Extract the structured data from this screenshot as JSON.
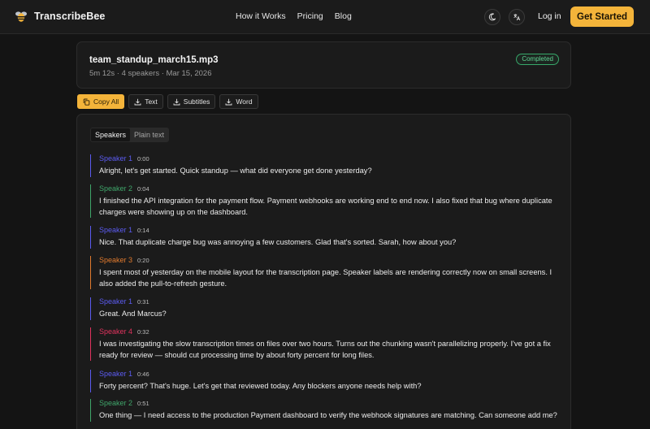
{
  "app": {
    "name": "TranscribeBee"
  },
  "nav": {
    "items": [
      "How it Works",
      "Pricing",
      "Blog"
    ]
  },
  "header": {
    "login_label": "Log in",
    "cta_label": "Get Started"
  },
  "file": {
    "name": "team_standup_march15.mp3",
    "meta": "5m 12s · 4 speakers · Mar 15, 2026",
    "status": "Completed"
  },
  "toolbar": {
    "copy_all": "Copy All",
    "text": "Text",
    "subtitles": "Subtitles",
    "word": "Word"
  },
  "view_toggle": {
    "speakers": "Speakers",
    "plain_text": "Plain text"
  },
  "colors": {
    "accent": "#f4b43a",
    "speaker_1": "#5b5bf0",
    "speaker_2": "#3fa56a",
    "speaker_3": "#e07a2e",
    "speaker_4": "#e0335e",
    "completed": "#5fd493"
  },
  "segments": [
    {
      "speaker": "Speaker 1",
      "time": "0:00",
      "color": "#5b5bf0",
      "text": "Alright, let's get started. Quick standup — what did everyone get done yesterday?"
    },
    {
      "speaker": "Speaker 2",
      "time": "0:04",
      "color": "#3fa56a",
      "text": "I finished the API integration for the payment flow. Payment webhooks are working end to end now. I also fixed that bug where duplicate charges were showing up on the dashboard."
    },
    {
      "speaker": "Speaker 1",
      "time": "0:14",
      "color": "#5b5bf0",
      "text": "Nice. That duplicate charge bug was annoying a few customers. Glad that's sorted. Sarah, how about you?"
    },
    {
      "speaker": "Speaker 3",
      "time": "0:20",
      "color": "#e07a2e",
      "text": "I spent most of yesterday on the mobile layout for the transcription page. Speaker labels are rendering correctly now on small screens. I also added the pull-to-refresh gesture."
    },
    {
      "speaker": "Speaker 1",
      "time": "0:31",
      "color": "#5b5bf0",
      "text": "Great. And Marcus?"
    },
    {
      "speaker": "Speaker 4",
      "time": "0:32",
      "color": "#e0335e",
      "text": "I was investigating the slow transcription times on files over two hours. Turns out the chunking wasn't parallelizing properly. I've got a fix ready for review — should cut processing time by about forty percent for long files."
    },
    {
      "speaker": "Speaker 1",
      "time": "0:46",
      "color": "#5b5bf0",
      "text": "Forty percent? That's huge. Let's get that reviewed today. Any blockers anyone needs help with?"
    },
    {
      "speaker": "Speaker 2",
      "time": "0:51",
      "color": "#3fa56a",
      "text": "One thing — I need access to the production Payment dashboard to verify the webhook signatures are matching. Can someone add me?"
    }
  ]
}
